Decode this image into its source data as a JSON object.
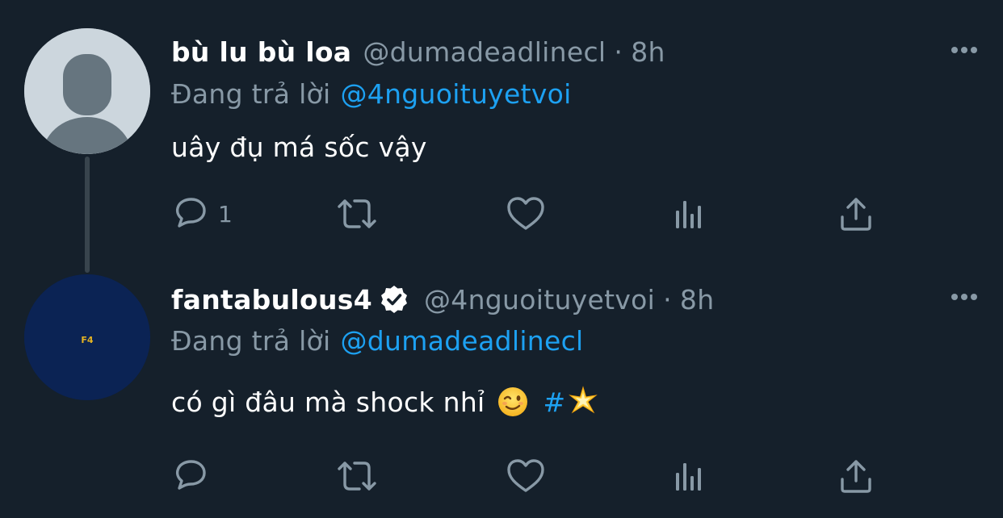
{
  "tweets": [
    {
      "display_name": "bù lu bù loa",
      "handle": "@dumadeadlinecl",
      "separator": "·",
      "time": "8h",
      "reply_prefix": "Đang trả lời",
      "reply_to": "@4nguoituyetvoi",
      "text": "uây đụ má sốc vậy",
      "reply_count": "1",
      "avatar_icon": "default-user-avatar"
    },
    {
      "display_name": "fantabulous4",
      "verified": true,
      "handle": "@4nguoituyetvoi",
      "separator": "·",
      "time": "8h",
      "reply_prefix": "Đang trả lời",
      "reply_to": "@dumadeadlinecl",
      "text": "có gì đâu mà shock nhỉ",
      "emoji": "winking-face-emoji",
      "hashtag": "#",
      "hashtag_emoji": "glowing-star-emoji",
      "reply_count": "",
      "avatar_text": "F4"
    }
  ],
  "colors": {
    "background": "#15202b",
    "text": "#ffffff",
    "secondary": "#8899a6",
    "accent": "#1da1f2",
    "thread_line": "#38444d"
  }
}
